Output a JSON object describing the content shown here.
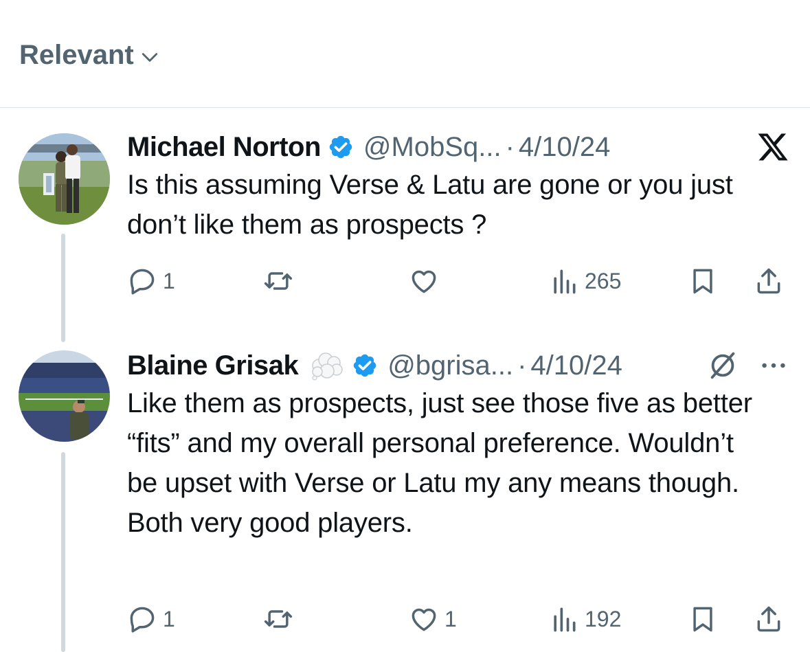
{
  "sort": {
    "label": "Relevant",
    "icon": "chevron-down-icon"
  },
  "colors": {
    "secondary": "#536471",
    "verified": "#1d9bf0",
    "thread_line": "#cfd9de"
  },
  "tweets": [
    {
      "name": "Michael Norton",
      "handle": "@MobSq...",
      "separator": "·",
      "date": "4/10/24",
      "text": "Is this assuming Verse & Latu are gone or you just don’t like them as prospects ?",
      "corner_icon": "x-logo-icon",
      "replies": "1",
      "retweets": "",
      "likes": "",
      "views": "265"
    },
    {
      "name": "Blaine Grisak",
      "name_badge": "cloud-icon",
      "handle": "@bgrisa...",
      "separator": "·",
      "date": "4/10/24",
      "text": "Like them as prospects, just see those five as better “fits” and my overall personal preference. Wouldn’t be upset with Verse or Latu my any means though. Both very good players.",
      "corner_icons": [
        "grok-icon",
        "more-icon"
      ],
      "replies": "1",
      "retweets": "",
      "likes": "1",
      "views": "192"
    }
  ]
}
